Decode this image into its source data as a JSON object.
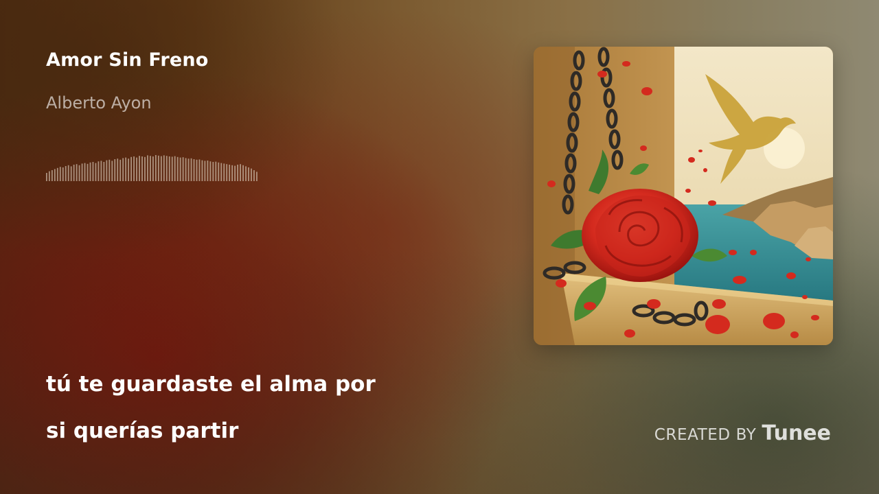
{
  "track": {
    "title": "Amor Sin Freno",
    "artist": "Alberto Ayon"
  },
  "waveform": {
    "color": "#c9b7a4",
    "levels": [
      0.3,
      0.36,
      0.4,
      0.44,
      0.48,
      0.52,
      0.5,
      0.55,
      0.58,
      0.54,
      0.6,
      0.62,
      0.58,
      0.64,
      0.66,
      0.63,
      0.68,
      0.7,
      0.66,
      0.72,
      0.74,
      0.7,
      0.76,
      0.78,
      0.74,
      0.8,
      0.82,
      0.78,
      0.84,
      0.86,
      0.82,
      0.88,
      0.9,
      0.86,
      0.92,
      0.9,
      0.88,
      0.94,
      0.92,
      0.9,
      0.95,
      0.93,
      0.91,
      0.94,
      0.92,
      0.9,
      0.89,
      0.91,
      0.88,
      0.86,
      0.87,
      0.84,
      0.82,
      0.83,
      0.8,
      0.78,
      0.79,
      0.76,
      0.74,
      0.75,
      0.72,
      0.7,
      0.71,
      0.68,
      0.66,
      0.64,
      0.62,
      0.6,
      0.58,
      0.56,
      0.6,
      0.62,
      0.58,
      0.54,
      0.5,
      0.46,
      0.4,
      0.34
    ]
  },
  "lyrics": {
    "line1": "tú te guardaste el alma por",
    "line2": "si querías partir"
  },
  "credit": {
    "prefix": "CREATED BY",
    "brand": "Tunee"
  },
  "colors": {
    "rose": "#d42a1e",
    "sea": "#2f8c93",
    "wall": "#c79a55",
    "sky": "#efe3c3"
  }
}
